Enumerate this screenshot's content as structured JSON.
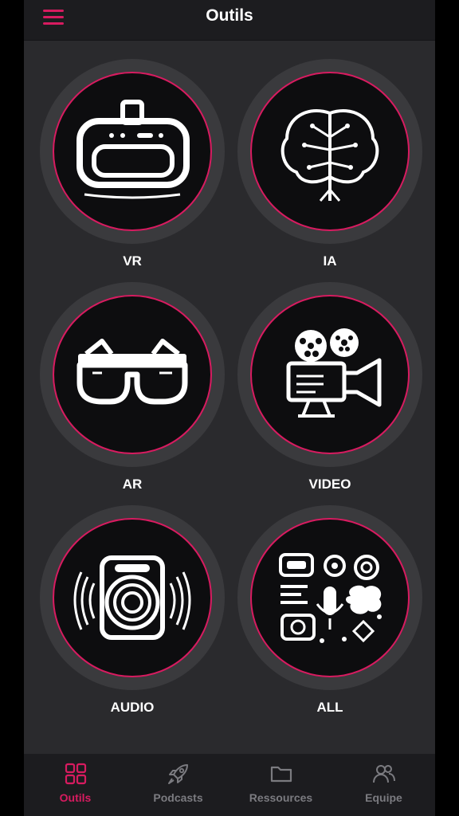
{
  "header": {
    "title": "Outils"
  },
  "tiles": [
    {
      "label": "VR",
      "icon": "vr-headset-icon"
    },
    {
      "label": "IA",
      "icon": "brain-circuit-icon"
    },
    {
      "label": "AR",
      "icon": "ar-glasses-icon"
    },
    {
      "label": "VIDEO",
      "icon": "film-camera-icon"
    },
    {
      "label": "AUDIO",
      "icon": "speaker-icon"
    },
    {
      "label": "ALL",
      "icon": "all-tools-collage-icon"
    }
  ],
  "tabs": [
    {
      "label": "Outils",
      "icon": "grid-icon",
      "active": true
    },
    {
      "label": "Podcasts",
      "icon": "rocket-icon",
      "active": false
    },
    {
      "label": "Ressources",
      "icon": "folder-icon",
      "active": false
    },
    {
      "label": "Equipe",
      "icon": "users-icon",
      "active": false
    }
  ],
  "colors": {
    "accent": "#d81b60",
    "background": "#2a2a2d",
    "bar": "#1c1c1f",
    "tab_inactive": "#7b7b80"
  }
}
